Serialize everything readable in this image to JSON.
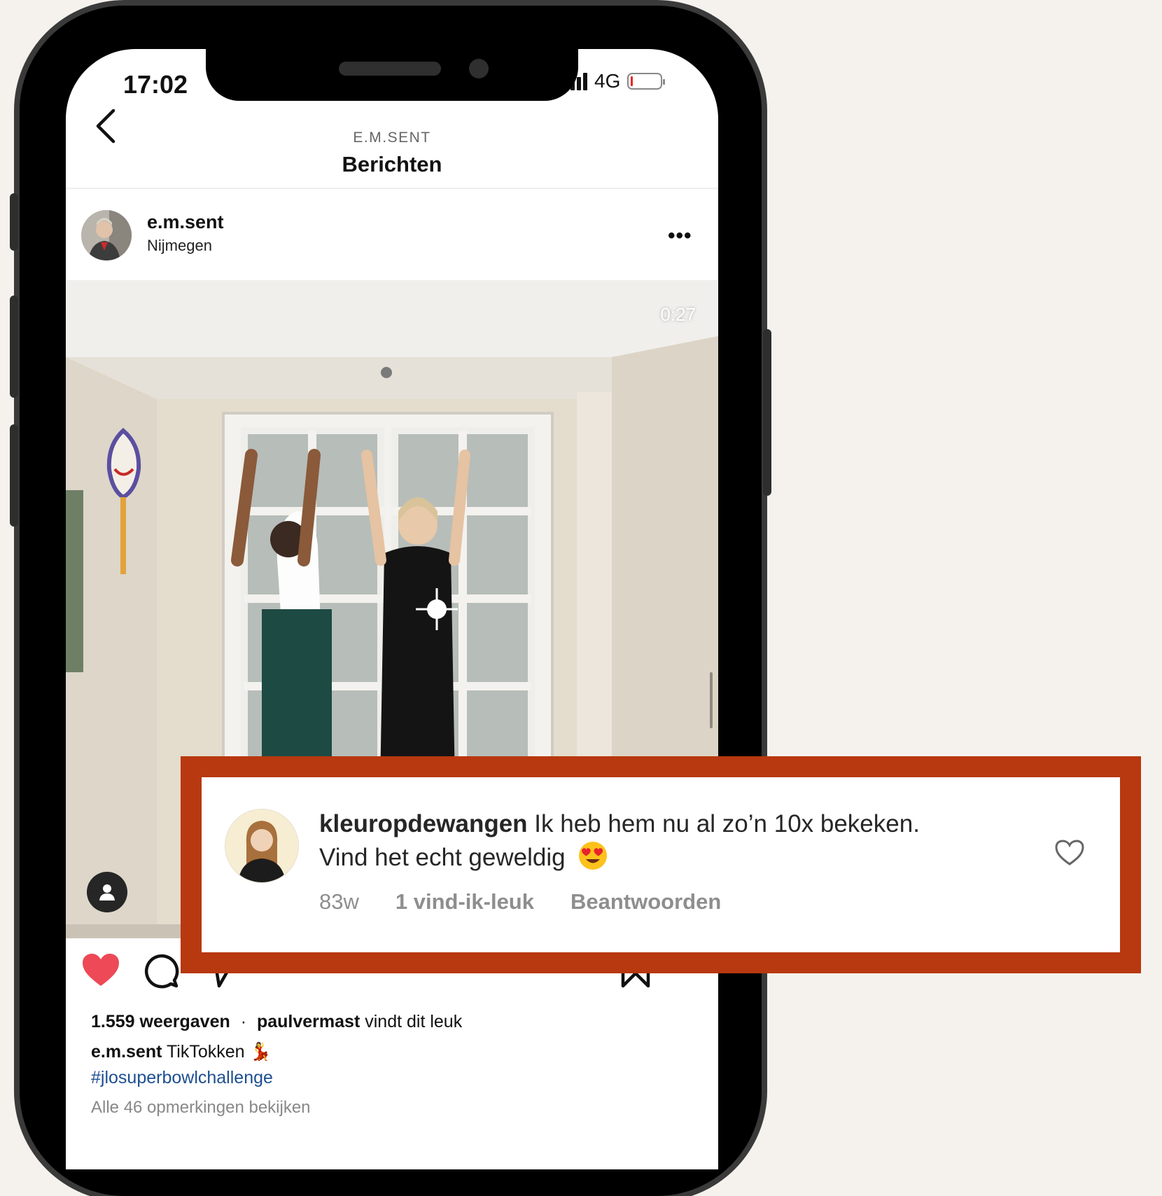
{
  "status_bar": {
    "time": "17:02",
    "network": "4G"
  },
  "nav": {
    "account": "E.M.SENT",
    "title": "Berichten"
  },
  "post": {
    "username": "e.m.sent",
    "location": "Nijmegen",
    "more_label": "•••",
    "video_duration": "0:27",
    "views": "1.559 weergaven",
    "separator": "·",
    "liked_by_user": "paulvermast",
    "liked_by_suffix": "vindt dit leuk",
    "caption_user": "e.m.sent",
    "caption_text": "TikTokken 💃",
    "hashtag": "#jlosuperbowlchallenge",
    "view_all_comments": "Alle 46 opmerkingen bekijken"
  },
  "comment": {
    "username": "kleuropdewangen",
    "text": "Ik heb hem nu al zo’n 10x bekeken. Vind het echt geweldig",
    "time": "83w",
    "likes": "1 vind-ik-leuk",
    "reply_label": "Beantwoorden"
  },
  "colors": {
    "background": "#f5f2ed",
    "callout_border": "#b8380f",
    "like_red": "#ed4956",
    "hashtag_blue": "#1d4f91"
  }
}
